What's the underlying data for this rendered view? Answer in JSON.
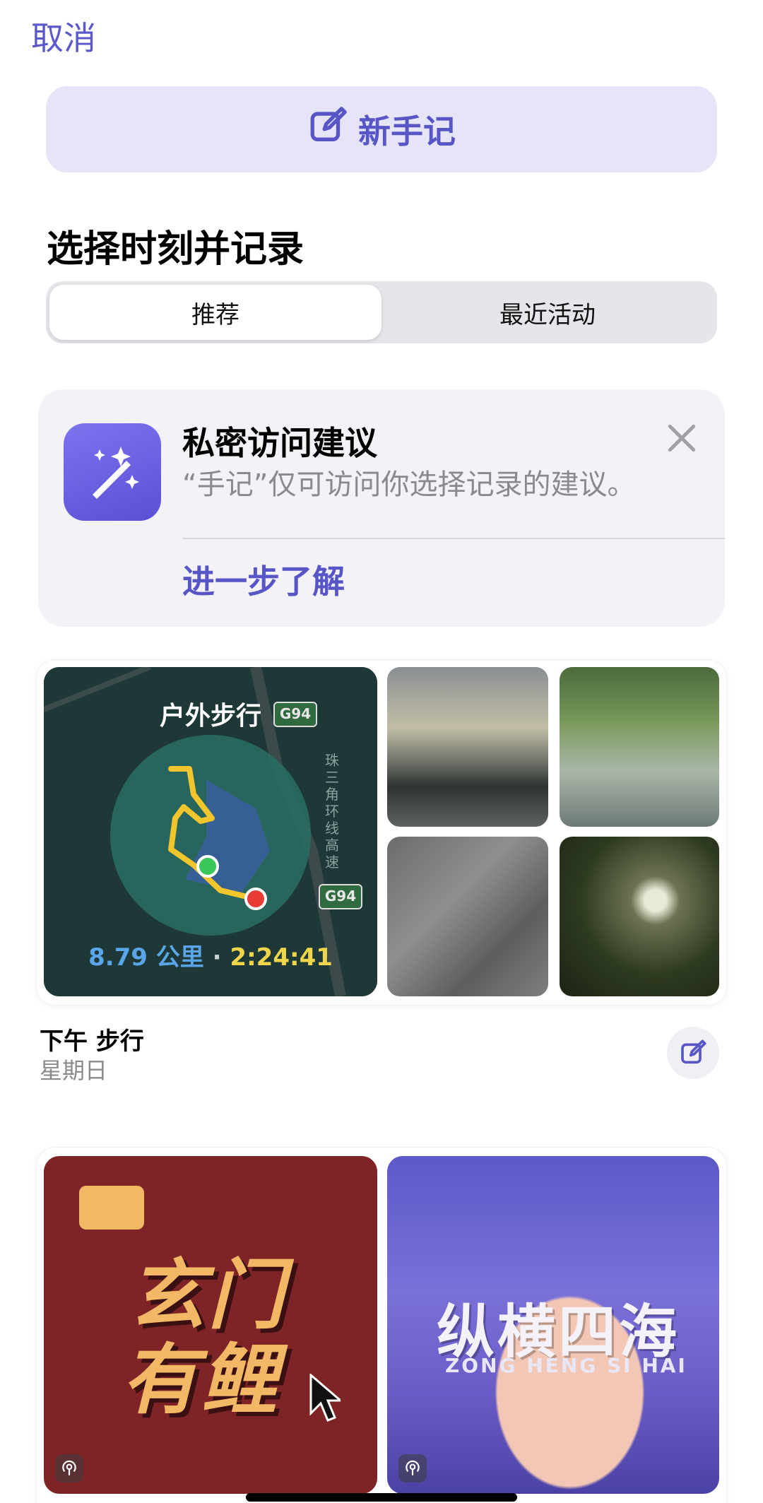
{
  "header": {
    "cancel_label": "取消"
  },
  "new_entry": {
    "label": "新手记",
    "icon": "compose-icon"
  },
  "section": {
    "title": "选择时刻并记录"
  },
  "segments": [
    {
      "label": "推荐",
      "active": true
    },
    {
      "label": "最近活动",
      "active": false
    }
  ],
  "privacy": {
    "icon": "magic-wand-icon",
    "title": "私密访问建议",
    "description": "“手记”仅可访问你选择记录的建议。",
    "learn_more": "进一步了解",
    "close_icon": "close-icon"
  },
  "moment": {
    "map": {
      "label": "户外步行",
      "distance": "8.79 公里",
      "separator": "·",
      "duration": "2:24:41",
      "road_sign": "G94",
      "road_name": "珠三角环线高速"
    },
    "title": "下午 步行",
    "subtitle": "星期日"
  },
  "podcasts": [
    {
      "title_line1": "玄门",
      "title_line2": "有鲤"
    },
    {
      "title": "纵横四海",
      "subtitle": "ZONG HENG SI HAI"
    }
  ],
  "colors": {
    "accent": "#5856c6",
    "accent_bg": "#e6e5f8",
    "card_bg": "#f2f2f7"
  }
}
